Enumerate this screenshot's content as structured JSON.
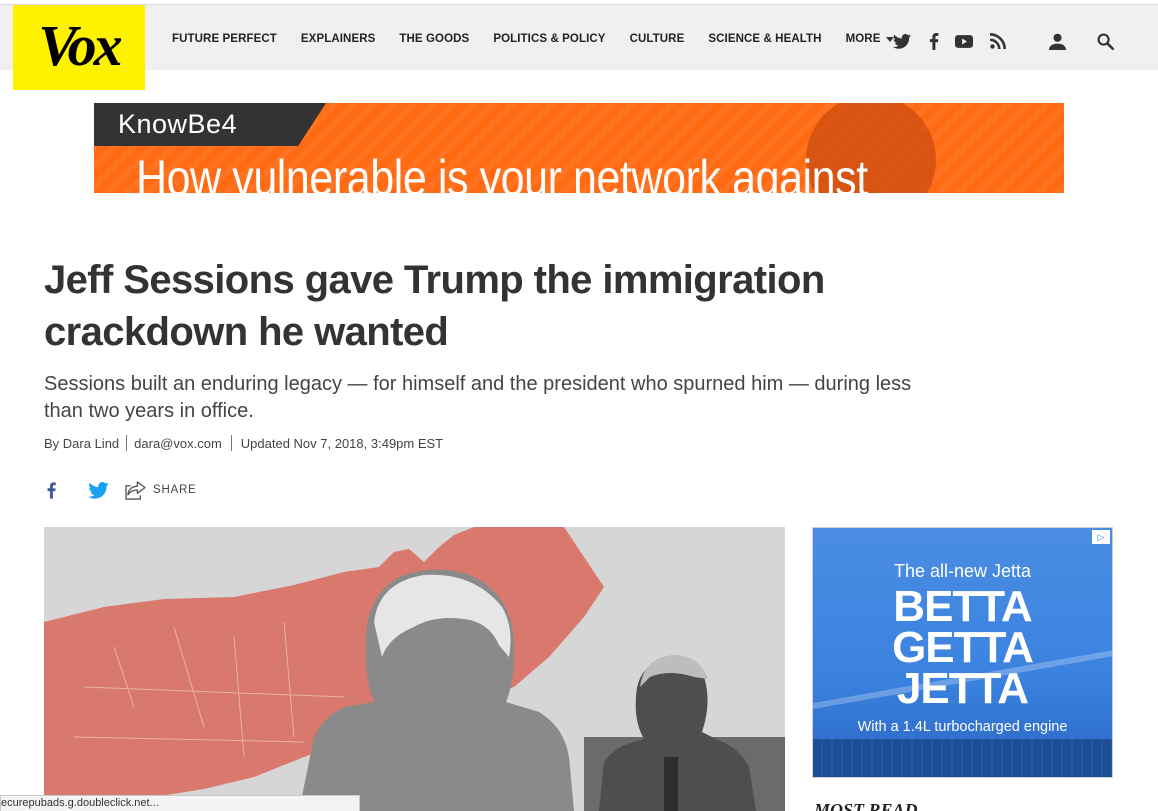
{
  "brand": {
    "logo_text": "Vox",
    "logo_color": "#fff200"
  },
  "nav": {
    "items": [
      {
        "label": "FUTURE PERFECT"
      },
      {
        "label": "EXPLAINERS"
      },
      {
        "label": "THE GOODS"
      },
      {
        "label": "POLITICS & POLICY"
      },
      {
        "label": "CULTURE"
      },
      {
        "label": "SCIENCE & HEALTH"
      }
    ],
    "more_label": "MORE",
    "icons": [
      "twitter-icon",
      "facebook-icon",
      "youtube-icon",
      "rss-icon",
      "user-icon",
      "search-icon"
    ]
  },
  "top_ad": {
    "brand": "KnowBe4",
    "headline": "How vulnerable is your network against",
    "color": "#ff6a13"
  },
  "article": {
    "headline": "Jeff Sessions gave Trump the immigration crackdown he wanted",
    "dek": "Sessions built an enduring legacy — for himself and the president who spurned him — during less than two years in office.",
    "byline": {
      "author": "By Dara Lind",
      "email": "dara@vox.com",
      "updated": "Updated Nov 7, 2018, 3:49pm EST"
    },
    "share_label": "SHARE"
  },
  "side_ad": {
    "top": "The all-new Jetta",
    "big_lines": [
      "BETTA",
      "GETTA",
      "JETTA"
    ],
    "bottom": "With a 1.4L turbocharged engine"
  },
  "most_read_label": "MOST READ",
  "status_bar": "ecurepubads.g.doubleclick.net..."
}
